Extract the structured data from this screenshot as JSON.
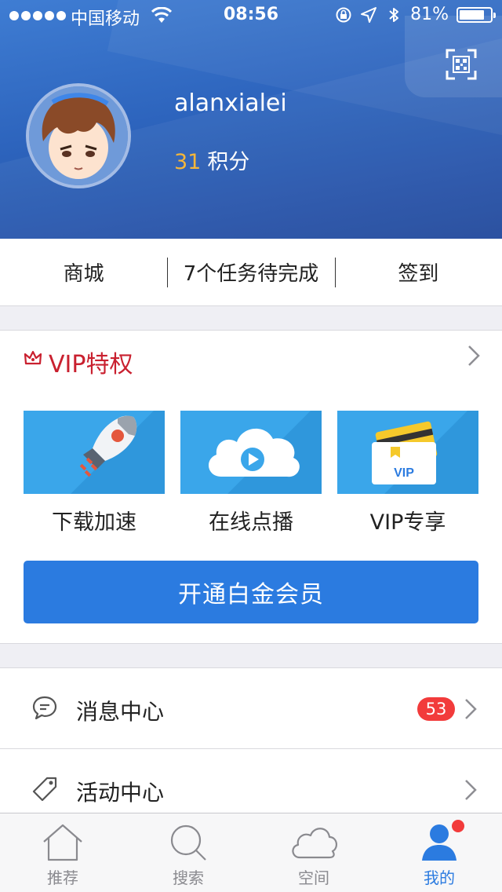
{
  "status_bar": {
    "carrier": "中国移动",
    "time": "08:56",
    "battery": "81%",
    "battery_level": 0.81
  },
  "profile": {
    "username": "alanxialei",
    "points_value": "31",
    "points_unit": "积分"
  },
  "quick_actions": [
    "商城",
    "7个任务待完成",
    "签到"
  ],
  "vip": {
    "title": "VIP特权",
    "features": [
      "下载加速",
      "在线点播",
      "VIP专享"
    ],
    "card_text": "VIP",
    "button_label": "开通白金会员"
  },
  "menu": {
    "items": [
      {
        "label": "消息中心",
        "badge": "53"
      },
      {
        "label": "活动中心"
      }
    ]
  },
  "tabs": [
    {
      "label": "推荐",
      "icon": "home-icon"
    },
    {
      "label": "搜索",
      "icon": "search-icon"
    },
    {
      "label": "空间",
      "icon": "cloud-icon"
    },
    {
      "label": "我的",
      "icon": "user-icon",
      "active": true
    }
  ],
  "colors": {
    "header_blue": "#2d64bd",
    "accent_blue": "#2b7be0",
    "vip_red": "#c9202f",
    "badge_red": "#f23b3b",
    "points_orange": "#f5b63a",
    "tile_blue": "#3aa6ea"
  }
}
